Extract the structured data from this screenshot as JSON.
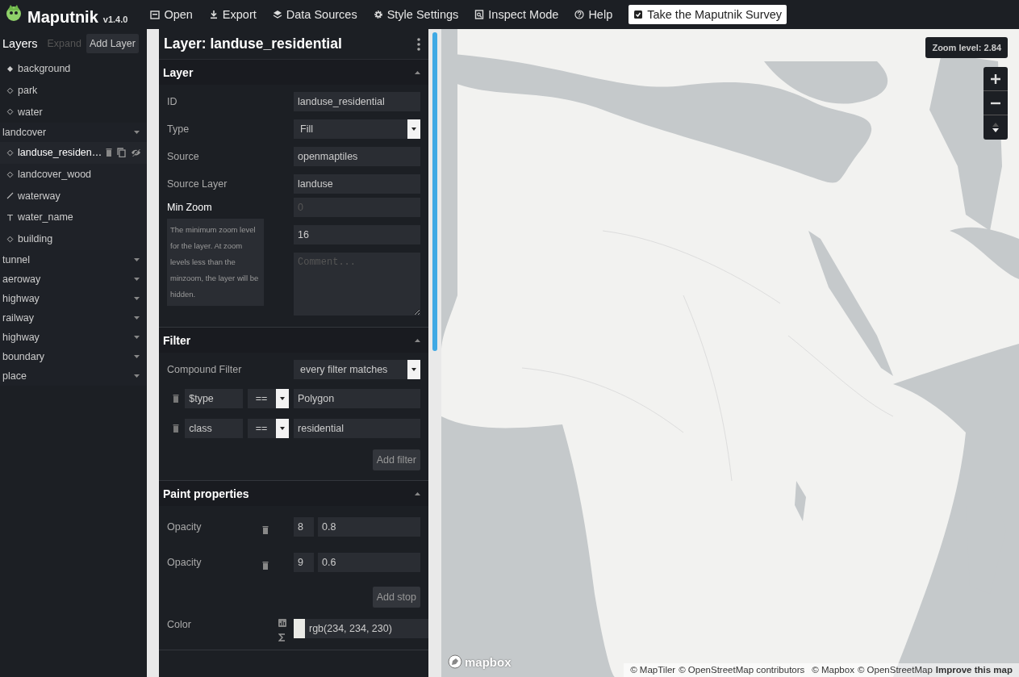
{
  "app": {
    "title": "Maputnik",
    "version": "v1.4.0"
  },
  "menu": [
    {
      "label": "Open",
      "kind": "open"
    },
    {
      "label": "Export",
      "kind": "export"
    },
    {
      "label": "Data Sources",
      "kind": "sources"
    },
    {
      "label": "Style Settings",
      "kind": "settings"
    },
    {
      "label": "Inspect Mode",
      "kind": "inspect"
    },
    {
      "label": "Help",
      "kind": "help"
    },
    {
      "label": "Take the Maputnik Survey",
      "kind": "survey"
    }
  ],
  "sidebar": {
    "title": "Layers",
    "buttons": [
      {
        "label": "Expand",
        "disabled": true
      },
      {
        "label": "Add Layer",
        "disabled": false
      }
    ],
    "layers": [
      {
        "kind": "background",
        "name": "background",
        "selected": false
      },
      {
        "kind": "fill",
        "name": "park",
        "selected": false
      },
      {
        "kind": "fill",
        "name": "water",
        "selected": false
      },
      {
        "kind": "group",
        "name": "landcover",
        "expanded": true,
        "children": [
          {
            "kind": "fill",
            "name": "landuse_residen…",
            "selected": true
          },
          {
            "kind": "fill",
            "name": "landcover_wood",
            "selected": false
          },
          {
            "kind": "line",
            "name": "waterway",
            "selected": false
          },
          {
            "kind": "symbol",
            "name": "water_name",
            "selected": false
          },
          {
            "kind": "fill",
            "name": "building",
            "selected": false
          }
        ]
      },
      {
        "kind": "group",
        "name": "tunnel",
        "expanded": false
      },
      {
        "kind": "group",
        "name": "aeroway",
        "expanded": false
      },
      {
        "kind": "group",
        "name": "highway",
        "expanded": false
      },
      {
        "kind": "group",
        "name": "railway",
        "expanded": false
      },
      {
        "kind": "group",
        "name": "highway",
        "expanded": false
      },
      {
        "kind": "group",
        "name": "boundary",
        "expanded": false
      },
      {
        "kind": "group",
        "name": "place",
        "expanded": false
      }
    ]
  },
  "editor": {
    "title": "Layer: landuse_residential",
    "sections": [
      {
        "kind": "layer",
        "title": "Layer",
        "expanded": true,
        "fields": [
          {
            "label": "ID",
            "kind": "input",
            "value": "landuse_residential"
          },
          {
            "label": "Type",
            "kind": "select",
            "value": "Fill"
          },
          {
            "label": "Source",
            "kind": "input",
            "value": "openmaptiles"
          },
          {
            "label": "Source Layer",
            "kind": "input",
            "value": "landuse"
          }
        ],
        "min_zoom": {
          "label": "Min Zoom",
          "placeholder": "0",
          "doc": "The minimum zoom level for the layer. At zoom levels less than the minzoom, the layer will be hidden."
        },
        "max_zoom": {
          "value": "16"
        },
        "comment": {
          "placeholder": "Comment..."
        }
      },
      {
        "kind": "filter",
        "title": "Filter",
        "expanded": true,
        "compound": {
          "label": "Compound Filter",
          "value": "every filter matches"
        },
        "filters": [
          {
            "key": "$type",
            "op": "==",
            "value": "Polygon"
          },
          {
            "key": "class",
            "op": "==",
            "value": "residential"
          }
        ],
        "button": "Add filter"
      },
      {
        "kind": "paint",
        "title": "Paint properties",
        "expanded": true,
        "stops": [
          {
            "label": "Opacity",
            "zoom": "8",
            "value": "0.8"
          },
          {
            "label": "Opacity",
            "zoom": "9",
            "value": "0.6"
          }
        ],
        "button": "Add stop",
        "color": {
          "label": "Color",
          "value": "rgb(234, 234, 230)"
        }
      }
    ]
  },
  "map": {
    "zoom_label": "Zoom level: 2.84",
    "logo": "mapbox",
    "attribution": [
      {
        "text": "© MapTiler",
        "kind": "text"
      },
      {
        "text": "© OpenStreetMap contributors",
        "kind": "text"
      },
      {
        "text": "© Mapbox",
        "kind": "text"
      },
      {
        "text": "© OpenStreetMap",
        "kind": "text"
      },
      {
        "text": "Improve this map",
        "kind": "link"
      }
    ]
  }
}
